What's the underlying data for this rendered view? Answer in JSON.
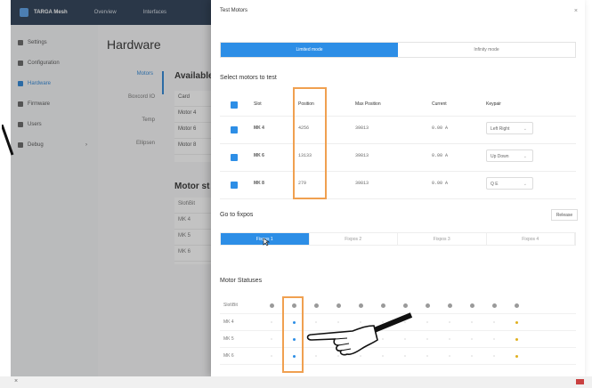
{
  "app": {
    "brand": "TARGA Mesh",
    "nav": [
      "Overview",
      "Interfaces"
    ]
  },
  "sidebar": {
    "items": [
      {
        "label": "Settings",
        "active": false
      },
      {
        "label": "Configuration",
        "active": false
      },
      {
        "label": "Hardware",
        "active": true
      },
      {
        "label": "Firmware",
        "active": false
      },
      {
        "label": "Users",
        "active": false
      },
      {
        "label": "Debug",
        "active": false,
        "chevron": "›"
      }
    ]
  },
  "main": {
    "title": "Hardware",
    "subnav": [
      "Motors",
      "Boxcord IO",
      "Temp",
      "Ellipsen"
    ],
    "available_heading": "Available",
    "card_header": "Card",
    "cards": [
      "Motor 4",
      "Motor 6",
      "Motor 8"
    ],
    "motor_status_heading": "Motor st",
    "status_header": "Slot\\Bit",
    "status_rows": [
      "MK 4",
      "MK 5",
      "MK 6"
    ]
  },
  "modal": {
    "title": "Test Motors",
    "close": "×",
    "modes": [
      {
        "label": "Limited mode",
        "active": true
      },
      {
        "label": "Infinity mode",
        "active": false
      }
    ],
    "select_label": "Select motors to test",
    "columns": [
      "Slot",
      "Position",
      "Max Position",
      "Current",
      "Keypair"
    ],
    "motors": [
      {
        "slot": "MK 4",
        "position": "4256",
        "max": "39813",
        "current": "0.00 A",
        "keypair": "Left Right"
      },
      {
        "slot": "MK 6",
        "position": "13133",
        "max": "39813",
        "current": "0.00 A",
        "keypair": "Up Down"
      },
      {
        "slot": "MK 8",
        "position": "279",
        "max": "39813",
        "current": "0.00 A",
        "keypair": "Q E"
      }
    ],
    "goto_label": "Go to fixpos",
    "release": "Release",
    "fixpos": [
      {
        "label": "Fixpos 1",
        "active": true
      },
      {
        "label": "Fixpos 2"
      },
      {
        "label": "Fixpos 3"
      },
      {
        "label": "Fixpos 4"
      }
    ],
    "statuses_label": "Motor Statuses",
    "status_header": "Slot\\Bit",
    "status_rows": [
      "MK 4",
      "MK 5",
      "MK 6"
    ]
  },
  "colors": {
    "accent": "#2d8ee6",
    "highlight": "#f0a050",
    "topbar": "#2c3e55",
    "warn": "#e0b020",
    "danger": "#c94040"
  },
  "icons": [
    "logo-icon",
    "chart-icon",
    "interfaces-icon",
    "close-icon",
    "checkbox-icon",
    "caret-down-icon",
    "hand-pointer-icon"
  ],
  "bottombar": {
    "close": "×"
  }
}
